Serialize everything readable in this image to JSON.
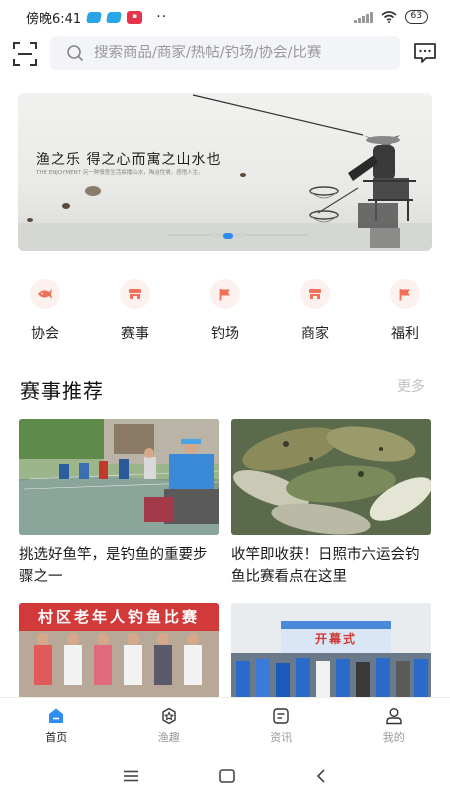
{
  "status_bar": {
    "time": "傍晚6:41",
    "battery": "63",
    "dots": "··"
  },
  "header": {
    "scan_icon": "scan-icon",
    "search_placeholder": "搜索商品/商家/热帖/钓场/协会/比赛",
    "message_icon": "message-icon"
  },
  "banner": {
    "title": "渔之乐  得之心而寓之山水也",
    "subtitle": "THE ENJOYMENT  另一种慢意生活探播山水，陶冶性情，感悟人生。",
    "active_index": 1,
    "count": 3
  },
  "categories": [
    {
      "label": "协会",
      "icon": "fish-icon"
    },
    {
      "label": "赛事",
      "icon": "shop-icon"
    },
    {
      "label": "钓场",
      "icon": "flag-icon"
    },
    {
      "label": "商家",
      "icon": "shop-icon"
    },
    {
      "label": "福利",
      "icon": "flag-icon"
    }
  ],
  "section": {
    "title": "赛事推荐",
    "more": "更多"
  },
  "cards": [
    {
      "title": "挑选好鱼竿，是钓鱼的重要步骤之一"
    },
    {
      "title": "收竿即收获！日照市六运会钓鱼比赛看点在这里"
    },
    {
      "title": "",
      "banner_text": "村区老年人钓鱼比赛"
    },
    {
      "title": "",
      "banner_text": "开幕式"
    }
  ],
  "bottom_nav": [
    {
      "label": "首页",
      "icon": "home-icon",
      "active": true
    },
    {
      "label": "渔趣",
      "icon": "star-box-icon",
      "active": false
    },
    {
      "label": "资讯",
      "icon": "news-icon",
      "active": false
    },
    {
      "label": "我的",
      "icon": "user-icon",
      "active": false
    }
  ],
  "colors": {
    "accent": "#2f8cf0",
    "category_icon": "#f0715a",
    "category_bg": "#fdf1ef",
    "search_bg": "#f2f4f7"
  }
}
